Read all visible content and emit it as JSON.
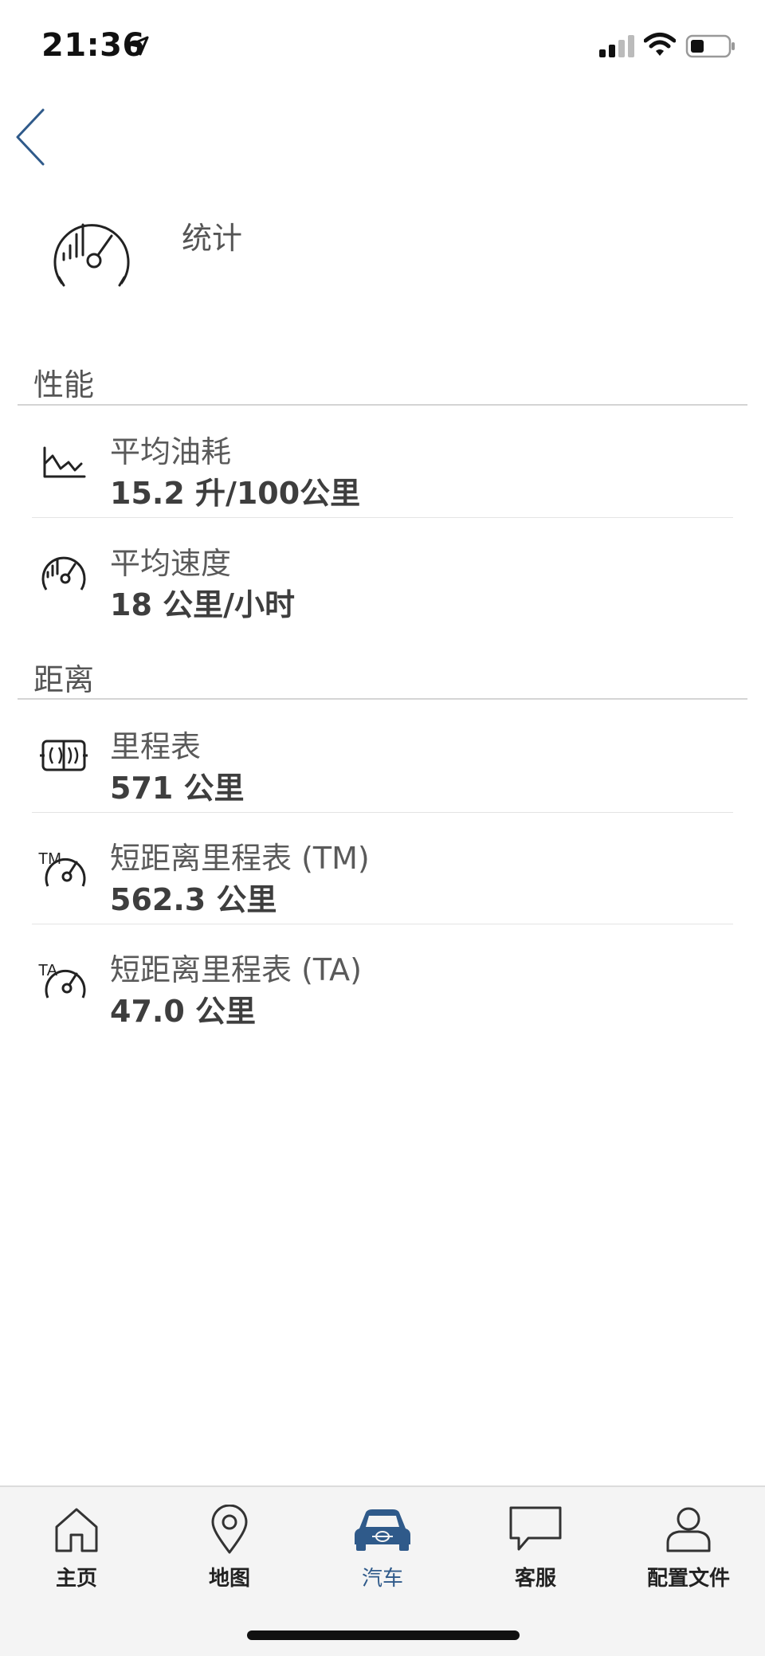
{
  "status_bar": {
    "time": "21:36",
    "icons": [
      "location-arrow-icon",
      "signal-bars-icon",
      "wifi-icon",
      "battery-icon"
    ]
  },
  "header": {
    "title": "统计",
    "icon": "gauge-icon"
  },
  "sections": {
    "performance": {
      "title": "性能",
      "rows": [
        {
          "label": "平均油耗",
          "value": "15.2 升/100公里",
          "icon": "fuel-chart-icon"
        },
        {
          "label": "平均速度",
          "value": "18 公里/小时",
          "icon": "speedometer-icon"
        }
      ]
    },
    "distance": {
      "title": "距离",
      "rows": [
        {
          "label": "里程表",
          "value": "571 公里",
          "icon": "odometer-icon"
        },
        {
          "label": "短距离里程表 (TM)",
          "value": "562.3 公里",
          "icon": "trip-meter-tm-icon",
          "badge": "TM"
        },
        {
          "label": "短距离里程表 (TA)",
          "value": "47.0 公里",
          "icon": "trip-meter-ta-icon",
          "badge": "TA"
        }
      ]
    }
  },
  "tab_bar": {
    "active": "汽车",
    "tabs": [
      {
        "label": "主页",
        "icon": "home-icon"
      },
      {
        "label": "地图",
        "icon": "map-pin-icon"
      },
      {
        "label": "汽车",
        "icon": "car-icon"
      },
      {
        "label": "客服",
        "icon": "chat-bubble-icon"
      },
      {
        "label": "配置文件",
        "icon": "profile-icon"
      }
    ]
  },
  "colors": {
    "accent": "#2f5a8a",
    "text": "#3a3a3a",
    "divider": "#d4d4d4",
    "tab_bar_bg": "#f4f4f4"
  }
}
